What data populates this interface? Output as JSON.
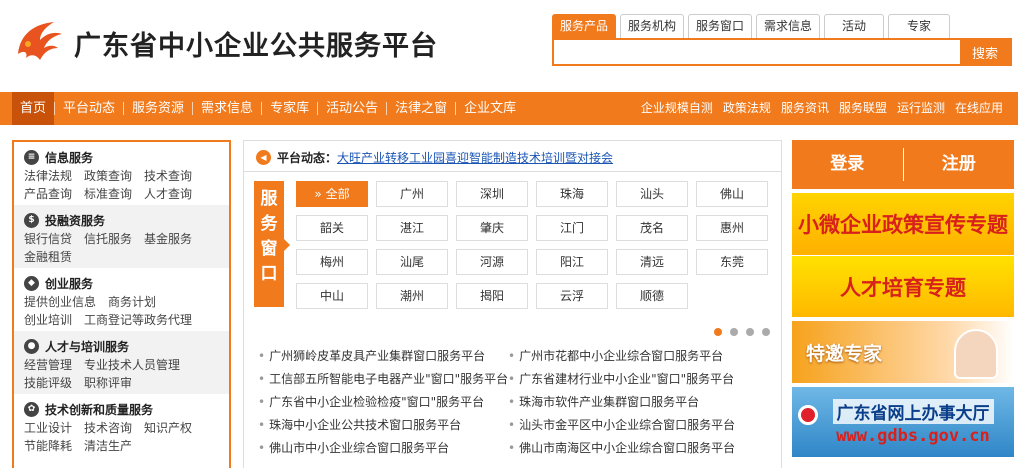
{
  "site": {
    "title": "广东省中小企业公共服务平台",
    "brand_color": "#f07a1c",
    "logo_icon": "phoenix-logo"
  },
  "search": {
    "tabs": [
      "服务产品",
      "服务机构",
      "服务窗口",
      "需求信息",
      "活动",
      "专家"
    ],
    "active_tab": "服务产品",
    "placeholder": "",
    "button_label": "搜索"
  },
  "nav": {
    "left": [
      "首页",
      "平台动态",
      "服务资源",
      "需求信息",
      "专家库",
      "活动公告",
      "法律之窗",
      "企业文库"
    ],
    "active": "首页",
    "right": [
      "企业规模自测",
      "政策法规",
      "服务资讯",
      "服务联盟",
      "运行监测",
      "在线应用"
    ]
  },
  "sidebar": {
    "groups": [
      {
        "title": "信息服务",
        "icon": "info-icon",
        "links": [
          "法律法规",
          "政策查询",
          "技术查询",
          "产品查询",
          "标准查询",
          "人才查询"
        ]
      },
      {
        "title": "投融资服务",
        "icon": "dollar-icon",
        "links": [
          "银行信贷",
          "信托服务",
          "基金服务",
          "金融租赁"
        ]
      },
      {
        "title": "创业服务",
        "icon": "startup-icon",
        "links": [
          "提供创业信息",
          "商务计划",
          "创业培训",
          "工商登记等政务代理"
        ]
      },
      {
        "title": "人才与培训服务",
        "icon": "person-icon",
        "links": [
          "经营管理",
          "专业技术人员管理",
          "技能评级",
          "职称评审"
        ]
      },
      {
        "title": "技术创新和质量服务",
        "icon": "gear-icon",
        "links": [
          "工业设计",
          "技术咨询",
          "知识产权",
          "节能降耗",
          "清洁生产"
        ]
      }
    ]
  },
  "center": {
    "news_label": "平台动态：",
    "news_link": "大旺产业转移工业园喜迎智能制造技术培训暨对接会",
    "service_label": [
      "服",
      "务",
      "窗",
      "口"
    ],
    "cities": [
      "» 全部",
      "广州",
      "深圳",
      "珠海",
      "汕头",
      "佛山",
      "韶关",
      "湛江",
      "肇庆",
      "江门",
      "茂名",
      "惠州",
      "梅州",
      "汕尾",
      "河源",
      "阳江",
      "清远",
      "东莞",
      "中山",
      "潮州",
      "揭阳",
      "云浮",
      "顺德"
    ],
    "active_city": "» 全部",
    "carousel_pages": 4,
    "carousel_active": 1,
    "windows": [
      "广州狮岭皮革皮具产业集群窗口服务平台",
      "广州市花都中小企业综合窗口服务平台",
      "工信部五所智能电子电器产业\"窗口\"服务平台",
      "广东省建材行业中小企业\"窗口\"服务平台",
      "广东省中小企业检验检疫\"窗口\"服务平台",
      "珠海市软件产业集群窗口服务平台",
      "珠海中小企业公共技术窗口服务平台",
      "汕头市金平区中小企业综合窗口服务平台",
      "佛山市中小企业综合窗口服务平台",
      "佛山市南海区中小企业综合窗口服务平台"
    ]
  },
  "right": {
    "login": "登录",
    "register": "注册",
    "banners": [
      "小微企业政策宣传专题",
      "人才培育专题",
      "特邀专家"
    ],
    "gdbs_name": "广东省网上办事大厅",
    "gdbs_url": "www.gdbs.gov.cn"
  }
}
